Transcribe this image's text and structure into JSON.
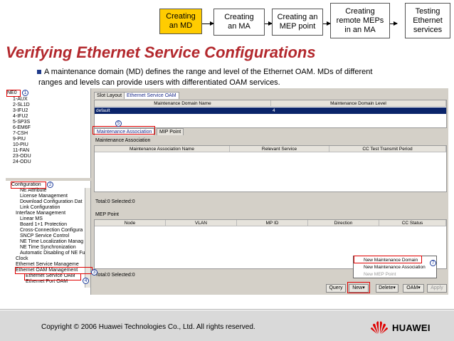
{
  "flow": {
    "steps": [
      {
        "label": "Creating\nan MD",
        "active": true
      },
      {
        "label": "Creating\nan MA",
        "active": false
      },
      {
        "label": "Creating an\nMEP point",
        "active": false
      },
      {
        "label": "Creating\nremote MEPs\nin an MA",
        "active": false
      },
      {
        "label": "Testing\nEthernet\nservices",
        "active": false
      }
    ],
    "active_color": "#ffcc00"
  },
  "title": "Verifying Ethernet Service Configurations",
  "bullet": {
    "line1": "A maintenance domain (MD) defines the range and level of the Ethernet OAM. MDs of different",
    "line2": "ranges and levels can provide users with differentiated OAM services."
  },
  "tree_top": {
    "root": "NE0",
    "items": [
      "1-AUX",
      "2-SL1D",
      "3-IFU2",
      "4-IFU2",
      "5-SP3S",
      "6-EM6F",
      "7-CSH",
      "9-PIU",
      "10-PIU",
      "11-FAN",
      "23-ODU",
      "24-ODU"
    ]
  },
  "tree_bottom": {
    "root": "Configuration",
    "items": [
      "NE Attribute",
      "License Management",
      "Download Configuration Dat",
      "Link Configuration",
      "Interface Management",
      "Linear MS",
      "Board 1+1 Protection",
      "Cross-Connection Configura",
      "SNCP Service Control",
      "NE Time Localization Manag",
      "NE Time Synchronization",
      "Automatic Disabling of NE Fu",
      "Clock",
      "Ethernet Service Manageme",
      "Ethernet OAM Management",
      "Ethernet Service OAM",
      "Ethernet Port OAM"
    ]
  },
  "tabs": {
    "slot_layout": "Slot Layout",
    "service_oam": "Ethernet Service OAM"
  },
  "md_table": {
    "headers": [
      "Maintenance Domain Name",
      "Maintenance Domain Level"
    ],
    "row": {
      "name": "default",
      "level": "4"
    }
  },
  "subtabs": {
    "association": "Maintenance Association",
    "mip": "MIP Point"
  },
  "ma_panel": {
    "label": "Maintenance Association",
    "headers": [
      "Maintenance Association Name",
      "Relevant Service",
      "CC Test Transmit Period"
    ],
    "status": "Total:0 Selected:0"
  },
  "mep_panel": {
    "label": "MEP Point",
    "headers": [
      "Node",
      "VLAN",
      "MP ID",
      "Direction",
      "CC Status"
    ],
    "status": "Total:0 Selected:0"
  },
  "buttons": {
    "query": "Query",
    "new": "New▾",
    "delete": "Delete▾",
    "oam": "OAM▾",
    "apply": "Apply"
  },
  "menu": {
    "items": [
      "New Maintenance Domain",
      "New Maintenance Association",
      "New MEP Point"
    ]
  },
  "markers": [
    "1",
    "2",
    "3",
    "4",
    "5",
    "6",
    "7"
  ],
  "footer": {
    "copyright": "Copyright © 2006 Huawei Technologies Co., Ltd. All rights reserved.",
    "brand": "HUAWEI"
  },
  "colors": {
    "title": "#b3282d",
    "annotation": "#e00000",
    "selection": "#0a246a",
    "logo": "#e00000"
  },
  "icons": [
    "huawei-logo-icon",
    "bullet-square-icon",
    "arrow-right-icon",
    "tree-expand-icon"
  ]
}
